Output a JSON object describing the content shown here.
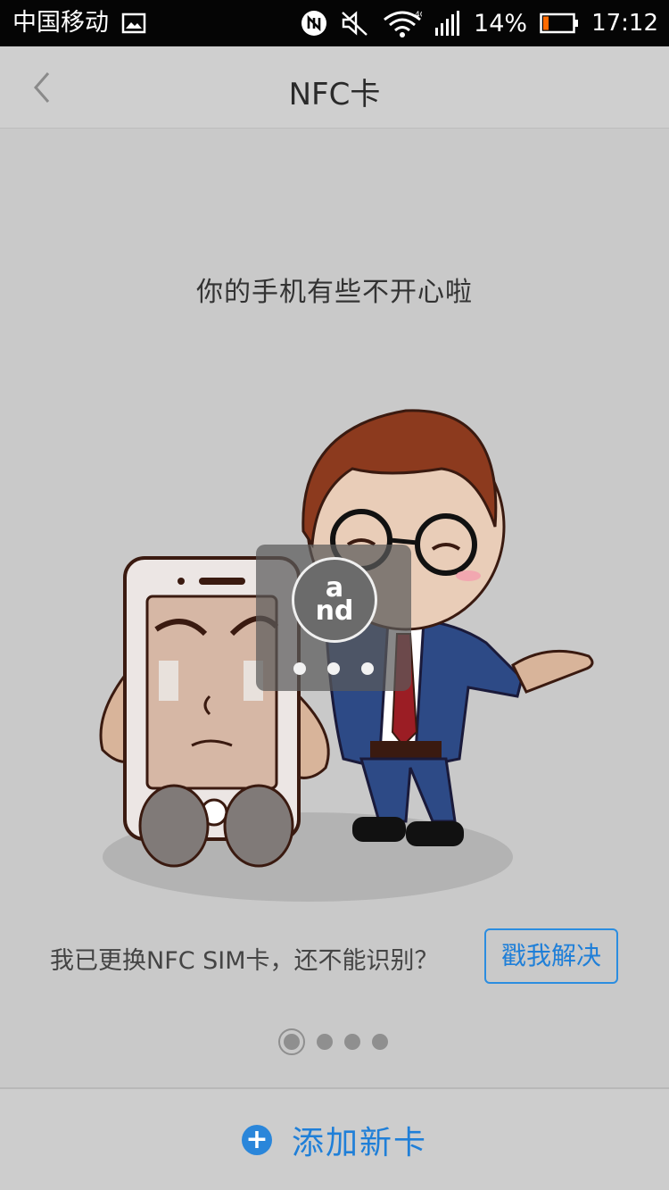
{
  "status_bar": {
    "carrier": "中国移动",
    "network": "4G",
    "battery_percent": "14%",
    "time": "17:12",
    "icons": [
      "image-icon",
      "nfc-icon",
      "mute-icon",
      "wifi-icon",
      "signal-icon",
      "battery-icon"
    ]
  },
  "app_bar": {
    "title": "NFC卡",
    "back_icon": "chevron-left-icon"
  },
  "main": {
    "headline": "你的手机有些不开心啦",
    "illustration": "sad-phone-and-man-illustration",
    "loading_overlay": {
      "logo_line1": "a",
      "logo_line2": "nd",
      "dots": 3
    },
    "help_text": "我已更换NFC SIM卡，还不能识别？",
    "help_button": "戳我解决",
    "pager": {
      "total": 4,
      "current": 1
    }
  },
  "footer": {
    "add_label": "添加新卡",
    "add_icon": "plus-circle-icon"
  },
  "colors": {
    "accent": "#1f7fd8",
    "background": "#c9c9c9",
    "status_bar": "#050505"
  }
}
